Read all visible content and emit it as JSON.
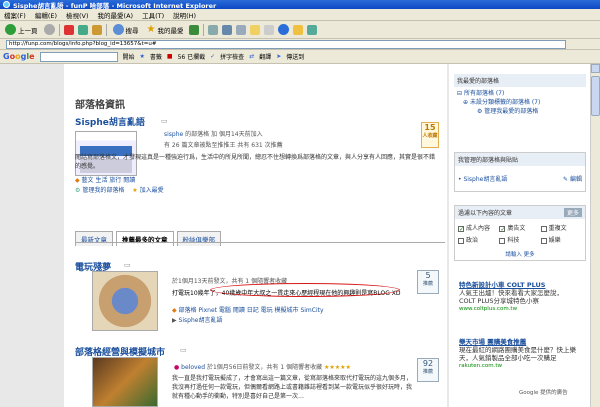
{
  "window": {
    "title": "Sisphe胡言亂語 - funP 哈部落 - Microsoft Internet Explorer"
  },
  "menu": [
    "檔案(F)",
    "編輯(E)",
    "檢視(V)",
    "我的最愛(A)",
    "工具(T)",
    "說明(H)"
  ],
  "toolbar": {
    "back_label": "上一頁",
    "search_label": "搜尋",
    "favorites_label": "我的最愛"
  },
  "address": {
    "url": "http://funp.com/blogs/info.php?blog_id=13657&t=u#"
  },
  "google_toolbar": {
    "start_label": "開始",
    "bookmark_label": "書籤",
    "blocked_label": "56 已攔截",
    "spellcheck_label": "拼字檢查",
    "translate_label": "翻譯",
    "send_label": "傳送到"
  },
  "main": {
    "section_title": "部落格資訊",
    "blog_title": "Sisphe胡言亂語",
    "owner": "sisphe",
    "owner_suffix": "的部落格 加 個月14天前加入",
    "posts_stats": "有 26 篇文章被點至推推王 共有 631 次推薦",
    "description": "閱話寫部落格文，才發現這真是一種強迫行爲，生活中的所見所聞，總忍不住想轉換爲部落格的文章，與人分享有人回應，其實是很不錯的感覺。",
    "tags": "藝文 生活 旅行 閱讀",
    "manage_link": "管理我的部落格",
    "add_favorite": "加入最愛",
    "badge_count": "15",
    "badge_label": "人收藏",
    "tabs": [
      "最新文章",
      "推薦最多的文章",
      "粉絲俱樂部"
    ],
    "article1": {
      "title": "電玩殘夢",
      "meta": "於1個月13天前發文，共有 1 個隨響者收藏",
      "body": "打電玩10幾年了，40幾歲中年大叔之一貫走來心歷經程現在他的興趣則是寫BLOG XD",
      "tags": "部落格 Pixnet 電腦 閱讀 日記 電玩 模擬城市 SimCity",
      "count": "5",
      "count_label": "推薦",
      "author": "Sisphe胡言亂語"
    },
    "article2": {
      "title": "部落格經營與模擬城市",
      "author": "beloved",
      "meta": "於1個月56日前發文，共有 1 個隨響者收藏",
      "body": "我一直是我打電玩擬成了，才會寫出這一篇文章，從寫部落格來取代打電玩的這九個多月，我沒再打過任何一款電玩，但偶爾看網路上或書籍雜誌裡看到某一款電玩似乎很好玩時，我就有種心動手的衝動，特別是喜好自己是第一次…",
      "count": "92",
      "count_label": "推薦"
    }
  },
  "sidebar": {
    "favorites_title": "我最愛的部落格",
    "my_blogs_label": "所有部落格 (7)",
    "uncategorized_label": "未設分類標籤的部落格 (7)",
    "manage_favorites": "管理我最愛的部落格",
    "my_managed_title": "我管理的部落格與貼贴",
    "my_blog": "Sisphe胡言亂語",
    "edit_label": "編輯",
    "filter_title": "過濾以下內容的文章",
    "more_label": "更多",
    "filters": [
      {
        "label": "成人內容",
        "checked": true
      },
      {
        "label": "廣告文",
        "checked": true
      },
      {
        "label": "重複文",
        "checked": false
      },
      {
        "label": "政治",
        "checked": false
      },
      {
        "label": "科技",
        "checked": false
      },
      {
        "label": "娛樂",
        "checked": false
      }
    ],
    "filter_hint": "請輸入 更多",
    "ad1_title": "人氣王出爐！快來看看大家怎麼說，COLT PLUS分享城特色小察",
    "ad1_head": "特色新設計小車 COLT PLUS",
    "ad1_url": "www.coltplus.com.tw",
    "ad2_head": "樂天市場 團購美食推薦",
    "ad2_body": "現在最紅的網路團購美食是什麼？快上樂天，人氣銷製品全部小吃一次購足",
    "ad2_url": "rakuten.com.tw",
    "google_ads_label": "Google 提供的廣告"
  }
}
